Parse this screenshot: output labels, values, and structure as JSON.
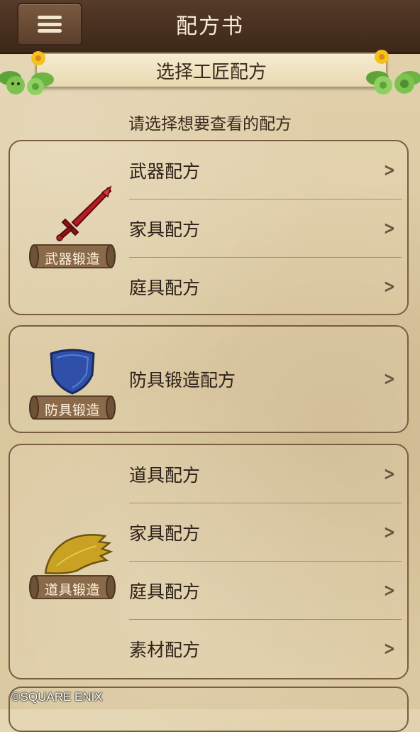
{
  "app_title": "配方书",
  "banner_title": "选择工匠配方",
  "subtitle": "请选择想要查看的配方",
  "sections": [
    {
      "badge": "武器锻造",
      "icon": "sword-icon",
      "items": [
        {
          "label": "武器配方"
        },
        {
          "label": "家具配方"
        },
        {
          "label": "庭具配方"
        }
      ]
    },
    {
      "badge": "防具锻造",
      "icon": "shield-icon",
      "items": [
        {
          "label": "防具锻造配方"
        }
      ]
    },
    {
      "badge": "道具锻造",
      "icon": "wing-icon",
      "items": [
        {
          "label": "道具配方"
        },
        {
          "label": "家具配方"
        },
        {
          "label": "庭具配方"
        },
        {
          "label": "素材配方"
        }
      ]
    }
  ],
  "copyright": "©SQUARE ENIX",
  "colors": {
    "header_bg": "#4a3322",
    "parchment": "#dccaa2",
    "card_border": "#7a5c40",
    "sword": "#b21e24",
    "shield": "#2f4fa8",
    "wing": "#c9a123"
  }
}
